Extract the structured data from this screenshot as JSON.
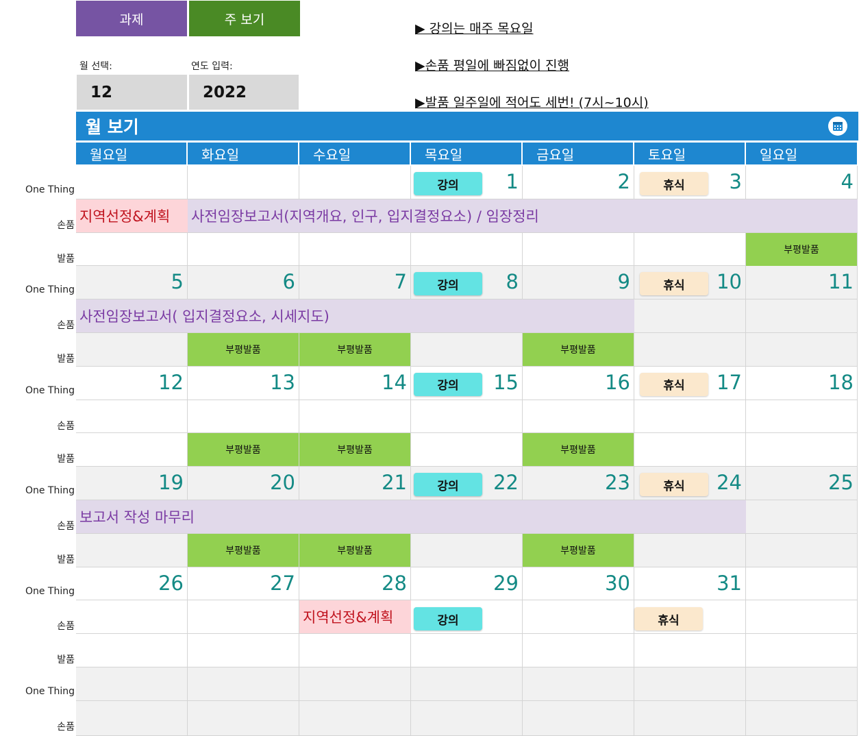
{
  "toolbar": {
    "tasks_label": "과제",
    "week_view_label": "주 보기"
  },
  "selector": {
    "month_label": "월 선택:",
    "month_value": "12",
    "year_label": "연도 입력:",
    "year_value": "2022"
  },
  "notes": [
    "▶ 강의는 매주 목요일",
    "▶손품 평일에 빠짐없이 진행",
    "▶발품 일주일에 적어도 세번! (7시~10시)"
  ],
  "banner": {
    "title": "월 보기",
    "icon": "calendar-icon"
  },
  "weekdays": [
    "월요일",
    "화요일",
    "수요일",
    "목요일",
    "금요일",
    "토요일",
    "일요일"
  ],
  "row_labels": {
    "one_thing": "One Thing",
    "sonpum": "손품",
    "balpum": "발품"
  },
  "weeks": [
    {
      "days": [
        "",
        "",
        "",
        "1",
        "2",
        "3",
        "4"
      ]
    },
    {
      "days": [
        "5",
        "6",
        "7",
        "8",
        "9",
        "10",
        "11"
      ]
    },
    {
      "days": [
        "12",
        "13",
        "14",
        "15",
        "16",
        "17",
        "18"
      ]
    },
    {
      "days": [
        "19",
        "20",
        "21",
        "22",
        "23",
        "24",
        "25"
      ]
    },
    {
      "days": [
        "26",
        "27",
        "28",
        "29",
        "30",
        "31",
        ""
      ]
    }
  ],
  "events": {
    "lecture": "강의",
    "rest": "휴식",
    "field_visit": "부평발품"
  },
  "tasks": {
    "region_plan": "지역선정&계획",
    "pre_report_1": "사전임장보고서(지역개요, 인구, 입지결정요소) / 임장정리",
    "pre_report_2": "사전임장보고서( 입지결정요소, 시세지도)",
    "report_finish": "보고서 작성 마무리",
    "region_plan_2": "지역선정&계획"
  },
  "colors": {
    "tasks_button": "#7654a3",
    "week_button": "#4a8a25",
    "header_blue": "#1e87d0",
    "day_number": "#148a85",
    "lecture_pill": "#63e3e3",
    "rest_pill": "#fbe8cd",
    "field_green": "#92d050",
    "purple_band": "#e1d9ea",
    "pink_band": "#fdd5d9"
  }
}
